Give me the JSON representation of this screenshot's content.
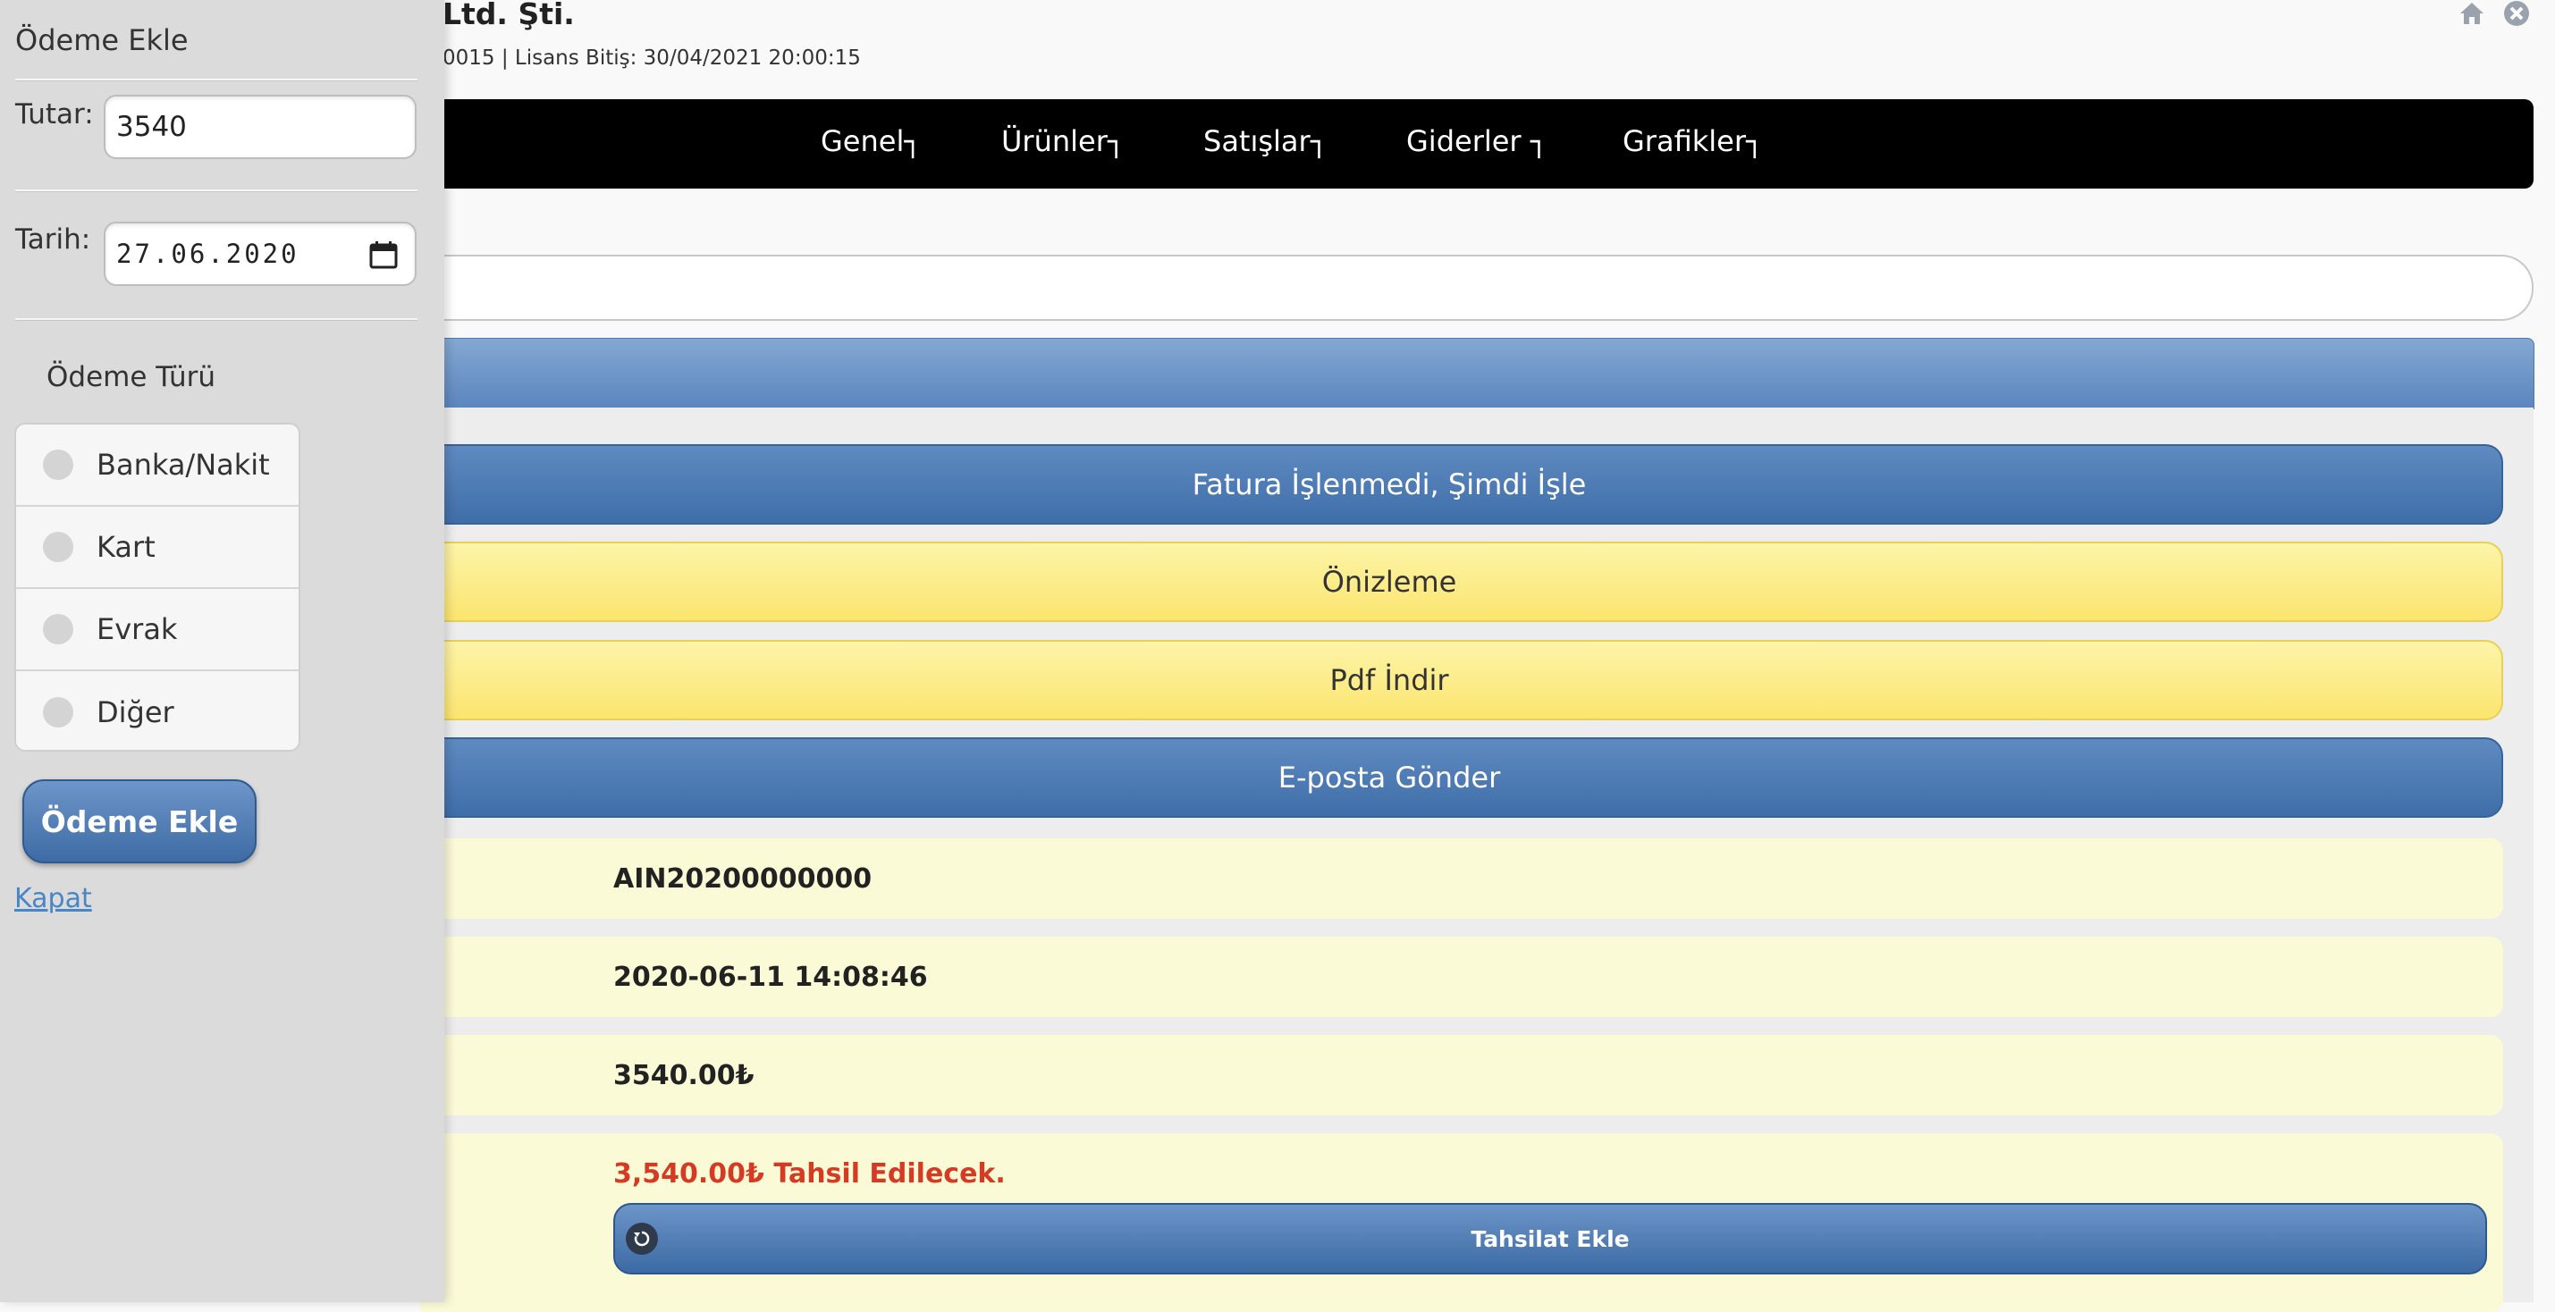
{
  "header": {
    "company": "Ltd. Şti.",
    "license": "0015 | Lisans Bitiş: 30/04/2021 20:00:15"
  },
  "nav": {
    "items": [
      "Genel┐",
      "Ürünler┐",
      "Satışlar┐",
      "Giderler ┐",
      "Grafikler┐"
    ]
  },
  "actions": {
    "process": "Fatura İşlenmedi, Şimdi İşle",
    "preview": "Önizleme",
    "pdf": "Pdf İndir",
    "email": "E-posta Gönder"
  },
  "invoice": {
    "number": "AIN20200000000",
    "date": "2020-06-11 14:08:46",
    "amount": "3540.00₺",
    "due": "3,540.00₺ Tahsil Edilecek.",
    "collect_label": "Tahsilat Ekle"
  },
  "panel": {
    "title": "Ödeme Ekle",
    "amount_label": "Tutar:",
    "amount_value": "3540",
    "date_label": "Tarih:",
    "date_value": "27.06.2020",
    "type_label": "Ödeme Türü",
    "types": [
      "Banka/Nakit",
      "Kart",
      "Evrak",
      "Diğer"
    ],
    "submit_label": "Ödeme Ekle",
    "close_label": "Kapat"
  },
  "colors": {
    "nav_bg": "#000000",
    "blue_button": "#4a77b0",
    "yellow_button": "#fbe56f",
    "info_row": "#fbfad7",
    "due_text": "#d53a22",
    "panel_bg": "#dbdbdb"
  }
}
